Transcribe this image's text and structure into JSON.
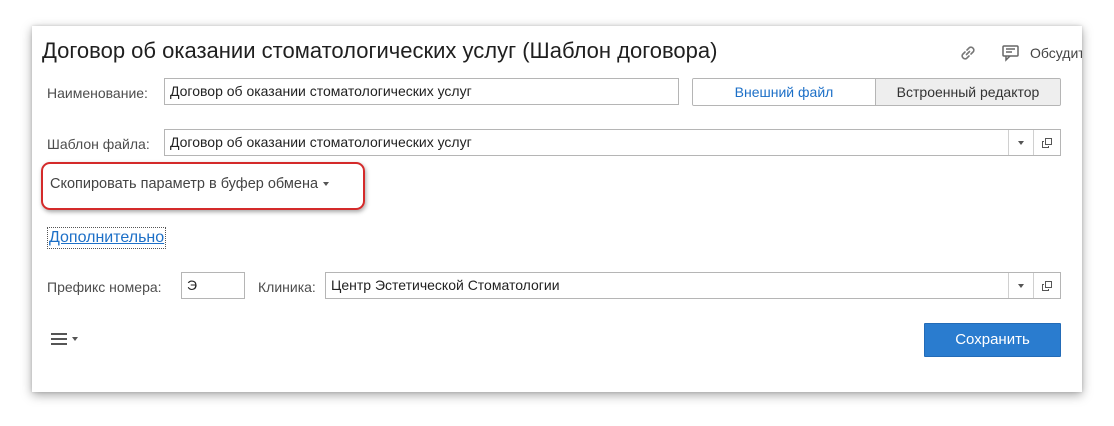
{
  "form": {
    "title": "Договор об оказании стоматологических услуг (Шаблон договора)",
    "discuss_label": "Обсудить"
  },
  "fields": {
    "name_label": "Наименование:",
    "name_value": "Договор об оказании стоматологических услуг",
    "template_label": "Шаблон файла:",
    "template_value": "Договор об оказании стоматологических услуг",
    "prefix_label": "Префикс номера:",
    "prefix_value": "Э",
    "clinic_label": "Клиника:",
    "clinic_value": "Центр Эстетической Стоматологии"
  },
  "buttons": {
    "external_file": "Внешний файл",
    "builtin_editor": "Встроенный редактор",
    "copy_param": "Скопировать параметр в буфер обмена",
    "more": "Дополнительно",
    "save": "Сохранить"
  },
  "icons": {
    "link": "link-icon",
    "discuss": "chat-bubble-icon",
    "menu": "hamburger-menu-icon",
    "open": "open-window-icon"
  },
  "colors": {
    "accent": "#1c6fc7",
    "save_button": "#2a7ccf",
    "highlight_frame": "#d42a2a"
  }
}
